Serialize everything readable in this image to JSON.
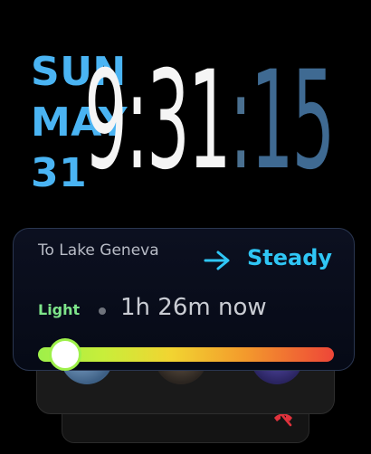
{
  "date": {
    "weekday": "SUN",
    "month": "MAY",
    "day": "31"
  },
  "time": {
    "hours_minutes": "9:31",
    "colon": ":",
    "seconds": "15"
  },
  "commute": {
    "destination": "To Lake Geneva",
    "trend_icon": "arrow-right-icon",
    "trend_label": "Steady",
    "traffic_label": "Light",
    "duration": "1h 26m now",
    "traffic_level": 0.03
  },
  "stack": {
    "avatars": [
      "avatar-1",
      "avatar-2",
      "avatar-3"
    ],
    "status_icon": "phone-muted-icon"
  },
  "colors": {
    "date_accent": "#4ab4f3",
    "seconds_accent": "#3f6a92",
    "steady_accent": "#2fc6f5",
    "traffic_light": "#7ee58a",
    "muted_red": "#e0323c"
  }
}
